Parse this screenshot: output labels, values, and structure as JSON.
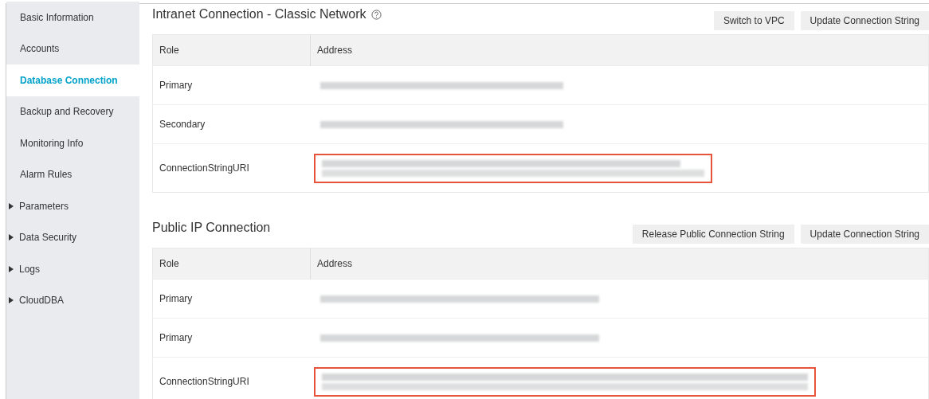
{
  "sidebar": {
    "items": [
      {
        "label": "Basic Information",
        "selected": false,
        "expandable": false
      },
      {
        "label": "Accounts",
        "selected": false,
        "expandable": false
      },
      {
        "label": "Database Connection",
        "selected": true,
        "expandable": false
      },
      {
        "label": "Backup and Recovery",
        "selected": false,
        "expandable": false
      },
      {
        "label": "Monitoring Info",
        "selected": false,
        "expandable": false
      },
      {
        "label": "Alarm Rules",
        "selected": false,
        "expandable": false
      },
      {
        "label": "Parameters",
        "selected": false,
        "expandable": true
      },
      {
        "label": "Data Security",
        "selected": false,
        "expandable": true
      },
      {
        "label": "Logs",
        "selected": false,
        "expandable": true
      },
      {
        "label": "CloudDBA",
        "selected": false,
        "expandable": true
      }
    ]
  },
  "sections": [
    {
      "title": "Intranet Connection - Classic Network",
      "help_icon": true,
      "buttons": [
        "Switch to VPC",
        "Update Connection String"
      ],
      "table": {
        "columns": [
          "Role",
          "Address"
        ],
        "rows": [
          {
            "role": "Primary",
            "kind": "host",
            "highlighted": false
          },
          {
            "role": "Secondary",
            "kind": "host",
            "highlighted": false
          },
          {
            "role": "ConnectionStringURI",
            "kind": "uri",
            "highlighted": true
          }
        ]
      }
    },
    {
      "title": "Public IP Connection",
      "help_icon": false,
      "buttons": [
        "Release Public Connection String",
        "Update Connection String"
      ],
      "table": {
        "columns": [
          "Role",
          "Address"
        ],
        "rows": [
          {
            "role": "Primary",
            "kind": "host",
            "highlighted": false
          },
          {
            "role": "Primary",
            "kind": "host",
            "highlighted": false
          },
          {
            "role": "ConnectionStringURI",
            "kind": "uri",
            "highlighted": true
          }
        ]
      }
    }
  ]
}
